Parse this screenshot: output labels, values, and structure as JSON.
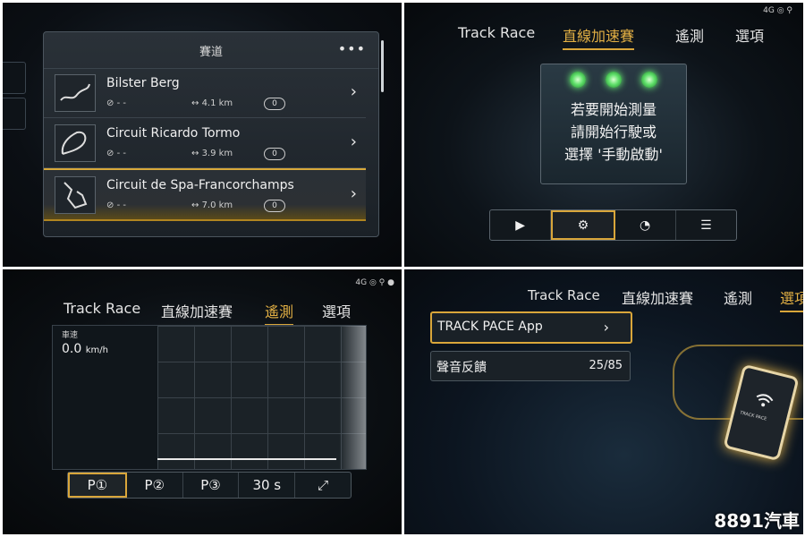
{
  "panel1": {
    "title": "賽道",
    "more": "•••",
    "tracks": [
      {
        "name": "Bilster Berg",
        "time": "- -",
        "distance": "4.1 km",
        "count": "0"
      },
      {
        "name": "Circuit Ricardo Tormo",
        "time": "- -",
        "distance": "3.9 km",
        "count": "0"
      },
      {
        "name": "Circuit de Spa-Francorchamps",
        "time": "- -",
        "distance": "7.0 km",
        "count": "0"
      }
    ]
  },
  "panel2": {
    "tabs": [
      "Track Race",
      "直線加速賽",
      "遙測",
      "選項"
    ],
    "active_tab": 1,
    "status": "4G",
    "instruction_lines": [
      "若要開始測量",
      "請開始行駛或",
      "選擇 '手動啟動'"
    ]
  },
  "panel3": {
    "tabs": [
      "Track Race",
      "直線加速賽",
      "遙測",
      "選項"
    ],
    "active_tab": 2,
    "status": "4G",
    "speed_label": "車速",
    "speed_value": "0.0",
    "speed_unit": "km/h",
    "buttons": [
      "P①",
      "P②",
      "P③",
      "30 s"
    ]
  },
  "panel4": {
    "tabs": [
      "Track Race",
      "直線加速賽",
      "遙測",
      "選項"
    ],
    "active_tab": 3,
    "menu": [
      {
        "label": "TRACK PACE App",
        "value": ""
      },
      {
        "label": "聲音反饋",
        "value": "25/85"
      }
    ],
    "phone_label": "TRACK PACE"
  },
  "watermark": "8891汽車",
  "colors": {
    "accent": "#d9a63a",
    "light_green": "#5fe06a"
  }
}
